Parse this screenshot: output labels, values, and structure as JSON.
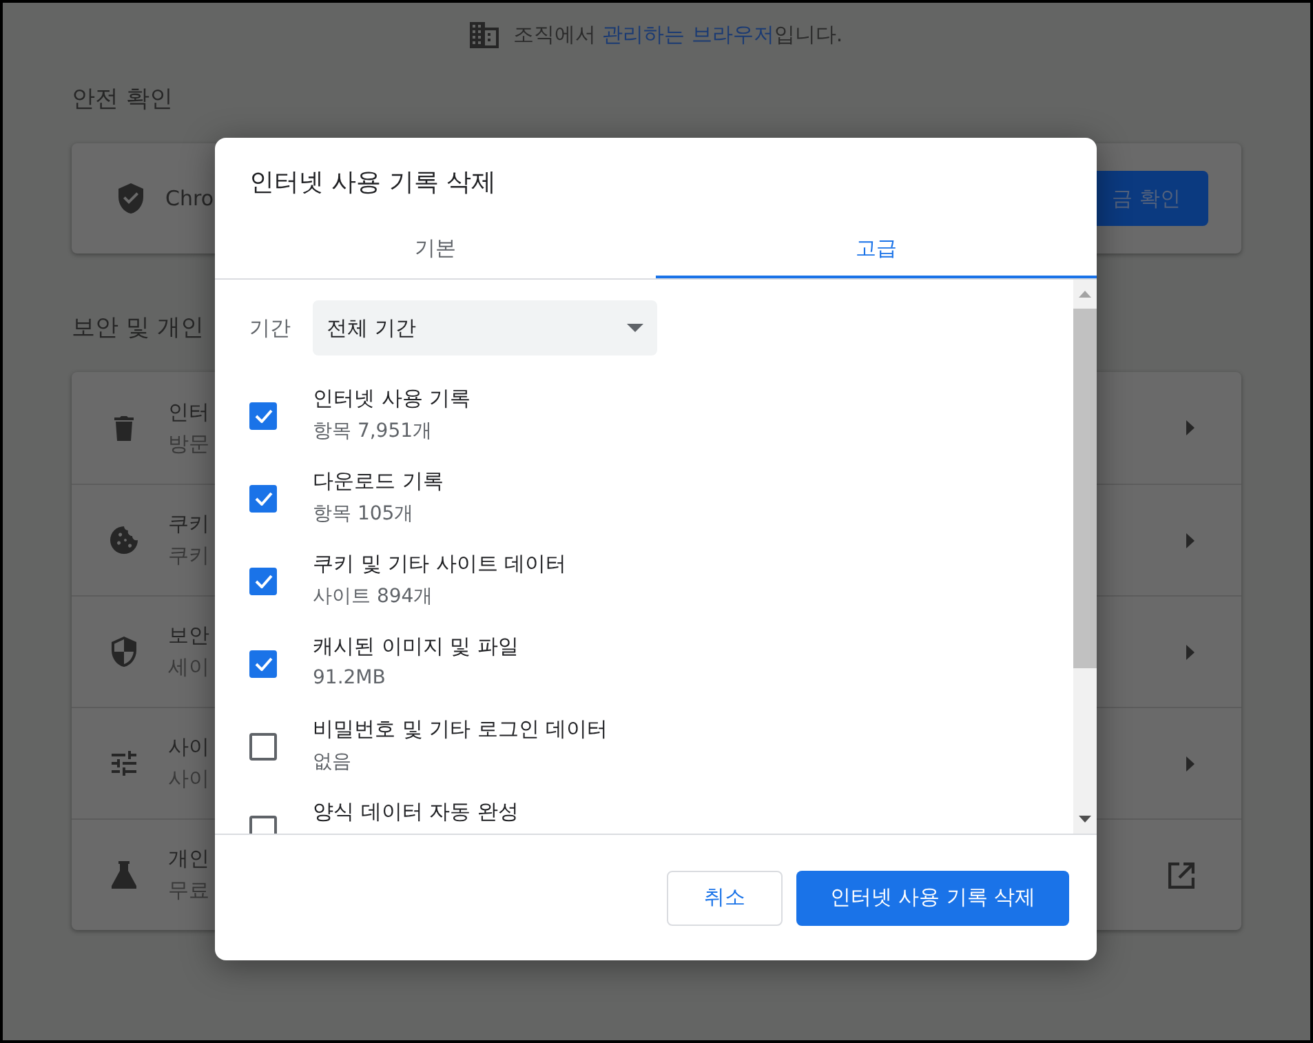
{
  "notice": {
    "prefix": "조직에서",
    "link": "관리하는 브라우저",
    "suffix": "입니다."
  },
  "safety_check": {
    "heading": "안전 확인",
    "text": "Chro",
    "button": "금 확인"
  },
  "privacy": {
    "heading": "보안 및 개인",
    "rows": [
      {
        "kind": "submenu",
        "title": "인터",
        "subtitle": "방문"
      },
      {
        "kind": "submenu",
        "title": "쿠키",
        "subtitle": "쿠키"
      },
      {
        "kind": "submenu",
        "title": "보안",
        "subtitle": "세이"
      },
      {
        "kind": "submenu",
        "title": "사이",
        "subtitle": "사이"
      },
      {
        "kind": "external",
        "title": "개인",
        "subtitle": "무료"
      }
    ]
  },
  "dialog": {
    "title": "인터넷 사용 기록 삭제",
    "tabs": [
      {
        "label": "기본",
        "selected": false
      },
      {
        "label": "고급",
        "selected": true
      }
    ],
    "time_range": {
      "label": "기간",
      "value": "전체 기간"
    },
    "items": [
      {
        "title": "인터넷 사용 기록",
        "detail": "항목 7,951개",
        "checked": true
      },
      {
        "title": "다운로드 기록",
        "detail": "항목 105개",
        "checked": true
      },
      {
        "title": "쿠키 및 기타 사이트 데이터",
        "detail": "사이트 894개",
        "checked": true
      },
      {
        "title": "캐시된 이미지 및 파일",
        "detail": "91.2MB",
        "checked": true
      },
      {
        "title": "비밀번호 및 기타 로그인 데이터",
        "detail": "없음",
        "checked": false
      },
      {
        "title": "양식 데이터 자동 완성",
        "checked": false
      }
    ],
    "buttons": [
      {
        "kind": "secondary",
        "label": "취소"
      },
      {
        "kind": "primary",
        "label": "인터넷 사용 기록 삭제"
      }
    ]
  }
}
